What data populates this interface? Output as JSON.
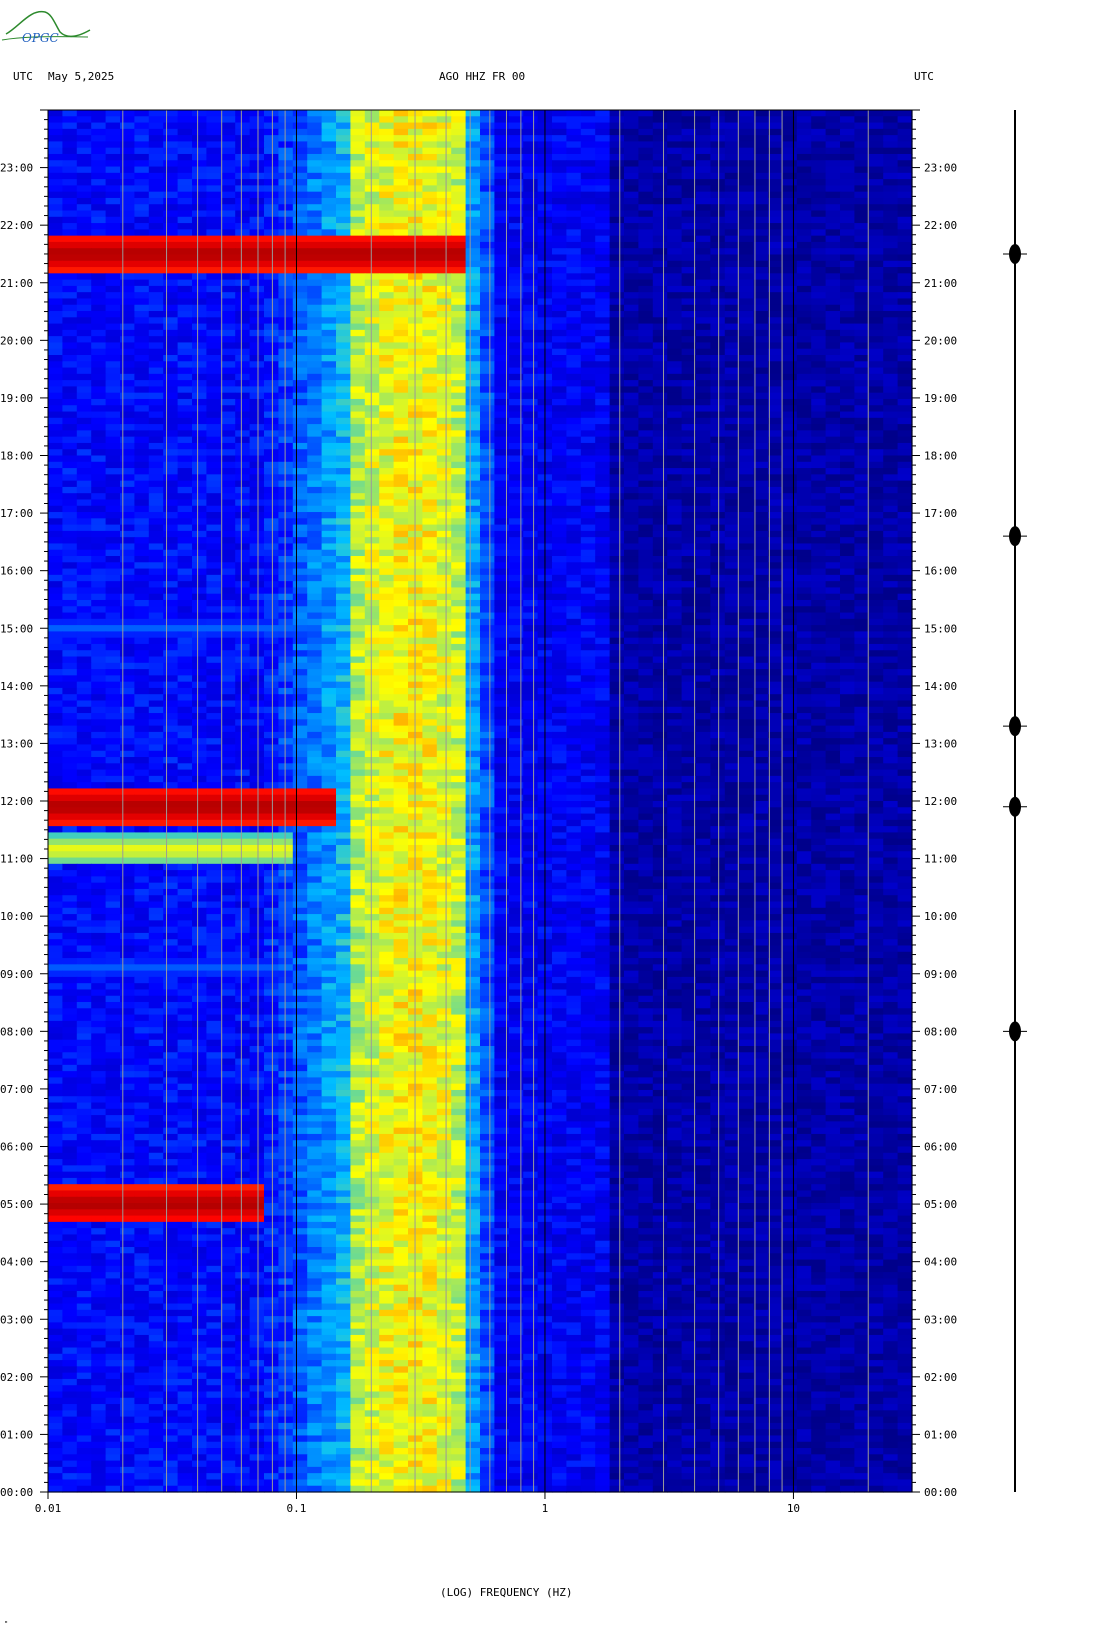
{
  "logo": {
    "text": "OPGC",
    "color": "#2d8a2d"
  },
  "header": {
    "left_tz": "UTC",
    "date": "May 5,2025",
    "station": "AGO HHZ FR 00",
    "right_tz": "UTC"
  },
  "footer": {
    "corner_mark": "\""
  },
  "chart_data": {
    "type": "heatmap",
    "title": "AGO HHZ FR 00",
    "xlabel": "(LOG) FREQUENCY (HZ)",
    "ylabel": "",
    "x_scale": "log",
    "xlim": [
      0.01,
      30
    ],
    "x_ticks": [
      0.01,
      0.1,
      1,
      10
    ],
    "x_tick_labels": [
      "0.01",
      "0.1",
      "1",
      "10"
    ],
    "ylim": [
      0,
      24
    ],
    "y_ticks": [
      "00:00",
      "01:00",
      "02:00",
      "03:00",
      "04:00",
      "05:00",
      "06:00",
      "07:00",
      "08:00",
      "09:00",
      "10:00",
      "11:00",
      "12:00",
      "13:00",
      "14:00",
      "15:00",
      "16:00",
      "17:00",
      "18:00",
      "19:00",
      "20:00",
      "21:00",
      "22:00",
      "23:00"
    ],
    "colormap": [
      "#00008b",
      "#0000ff",
      "#00bfff",
      "#ffff00",
      "#ff0000",
      "#8b0000"
    ],
    "background_band": {
      "freq_range": [
        0.16,
        0.45
      ],
      "description_level": "high"
    },
    "events": [
      {
        "time": 21.5,
        "freq_max": 0.5,
        "intensity": "strong"
      },
      {
        "time": 11.9,
        "freq_max": 0.15,
        "intensity": "strong"
      },
      {
        "time": 11.15,
        "freq_max": 0.1,
        "intensity": "medium"
      },
      {
        "time": 9.1,
        "freq_max": 0.1,
        "intensity": "weak"
      },
      {
        "time": 5.0,
        "freq_max": 0.07,
        "intensity": "strong"
      },
      {
        "time": 15.0,
        "freq_max": 0.1,
        "intensity": "weak"
      }
    ],
    "seismogram": {
      "position": "right",
      "spikes_at": [
        21.5,
        11.9,
        13.3,
        8.0,
        16.6
      ]
    }
  }
}
